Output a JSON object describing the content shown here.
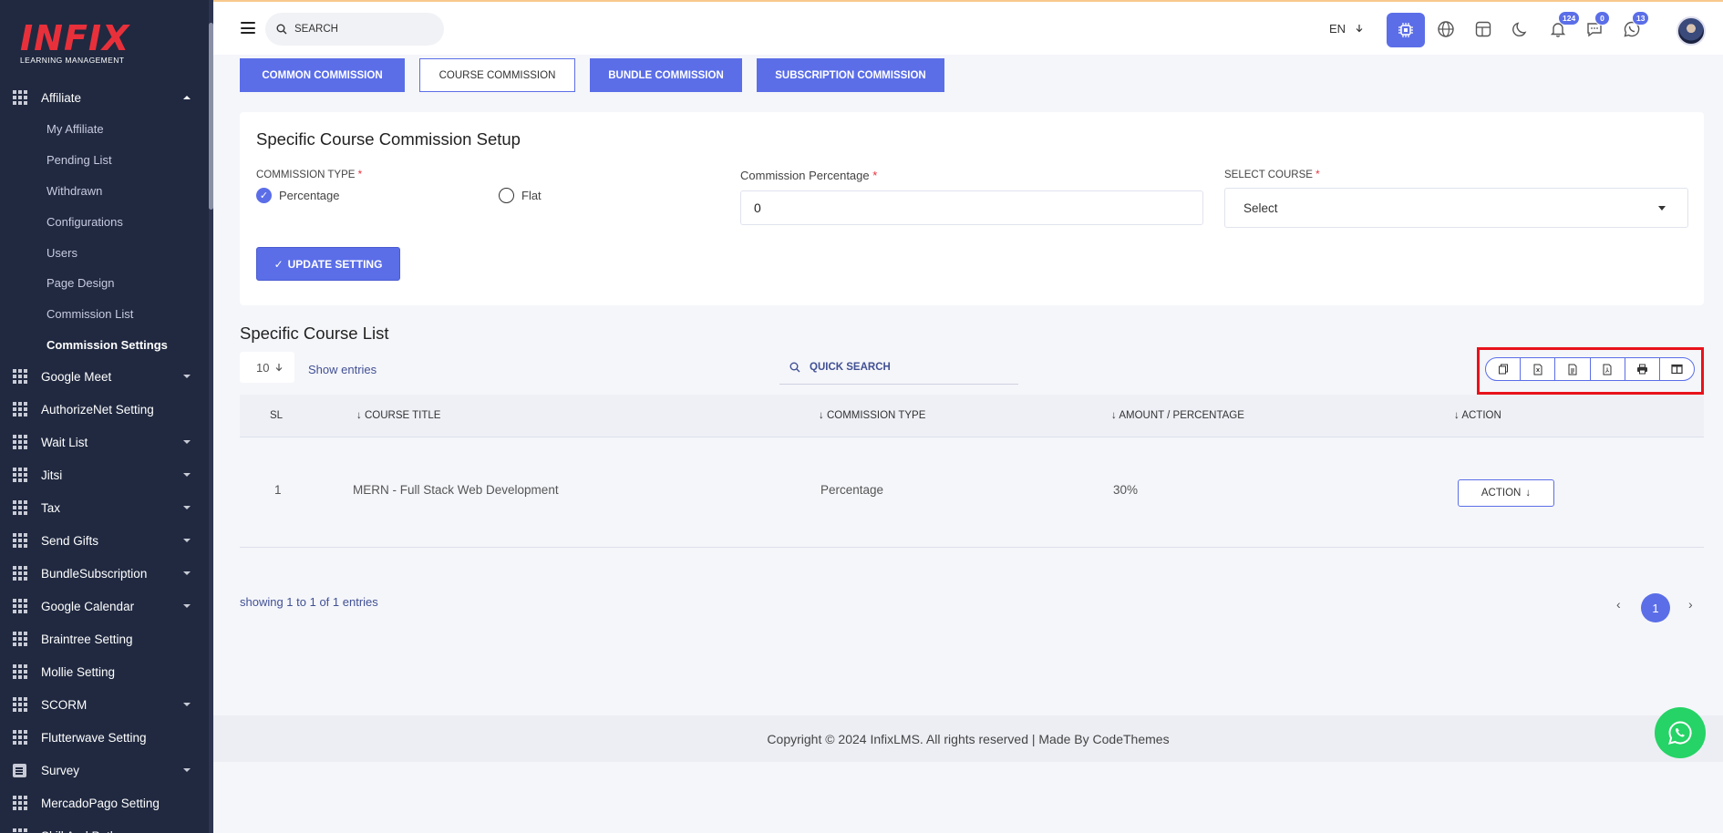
{
  "brand": {
    "logo_text": "INFIX",
    "logo_sub": "LEARNING MANAGEMENT"
  },
  "sidebar": {
    "parent": {
      "label": "Affiliate",
      "expanded": true
    },
    "submenu": [
      {
        "label": "My Affiliate"
      },
      {
        "label": "Pending List"
      },
      {
        "label": "Withdrawn"
      },
      {
        "label": "Configurations"
      },
      {
        "label": "Users"
      },
      {
        "label": "Page Design"
      },
      {
        "label": "Commission List"
      },
      {
        "label": "Commission Settings",
        "active": true
      }
    ],
    "items": [
      {
        "label": "Google Meet",
        "has_children": true
      },
      {
        "label": "AuthorizeNet Setting",
        "has_children": false
      },
      {
        "label": "Wait List",
        "has_children": true
      },
      {
        "label": "Jitsi",
        "has_children": true
      },
      {
        "label": "Tax",
        "has_children": true
      },
      {
        "label": "Send Gifts",
        "has_children": true
      },
      {
        "label": "BundleSubscription",
        "has_children": true
      },
      {
        "label": "Google Calendar",
        "has_children": true
      },
      {
        "label": "Braintree Setting",
        "has_children": false
      },
      {
        "label": "Mollie Setting",
        "has_children": false
      },
      {
        "label": "SCORM",
        "has_children": true
      },
      {
        "label": "Flutterwave Setting",
        "has_children": false
      },
      {
        "label": "Survey",
        "has_children": true,
        "icon": "document-icon"
      },
      {
        "label": "MercadoPago Setting",
        "has_children": false
      },
      {
        "label": "Skill And Pathway",
        "has_children": true
      }
    ]
  },
  "topbar": {
    "search_placeholder": "SEARCH",
    "language": "EN",
    "notifications_count": "124",
    "messages_count": "0",
    "whatsapp_count": "13"
  },
  "tabs": [
    {
      "label": "COMMON COMMISSION",
      "active": false
    },
    {
      "label": "COURSE COMMISSION",
      "active": true
    },
    {
      "label": "BUNDLE COMMISSION",
      "active": false
    },
    {
      "label": "SUBSCRIPTION COMMISSION",
      "active": false
    }
  ],
  "setup": {
    "title": "Specific Course Commission Setup",
    "commission_type_label": "COMMISSION TYPE",
    "option_percentage": "Percentage",
    "option_flat": "Flat",
    "selected_option": "Percentage",
    "percentage_label": "Commission Percentage",
    "percentage_value": "0",
    "course_label": "SELECT COURSE",
    "course_value": "Select",
    "update_button": "UPDATE SETTING",
    "required_marker": "*"
  },
  "list": {
    "title": "Specific Course List",
    "page_size": "10",
    "show_entries": "Show entries",
    "search_placeholder": "QUICK SEARCH",
    "export_icons": [
      "copy-icon",
      "csv-icon",
      "excel-icon",
      "pdf-icon",
      "print-icon",
      "columns-icon"
    ],
    "columns": [
      "SL",
      "COURSE TITLE",
      "COMMISSION TYPE",
      "AMOUNT / PERCENTAGE",
      "ACTION"
    ],
    "rows": [
      {
        "sl": "1",
        "course_title": "MERN - Full Stack Web Development",
        "commission_type": "Percentage",
        "amount": "30%",
        "action": "ACTION"
      }
    ],
    "showing": "showing 1 to 1 of 1 entries",
    "current_page": "1"
  },
  "footer": {
    "text": "Copyright © 2024 InfixLMS. All rights reserved | Made By CodeThemes"
  },
  "colors": {
    "accent": "#5b6ee8",
    "sidebar_bg": "#202940",
    "logo_red": "#e8303b",
    "highlight": "#e8121b",
    "whatsapp": "#25d366"
  }
}
